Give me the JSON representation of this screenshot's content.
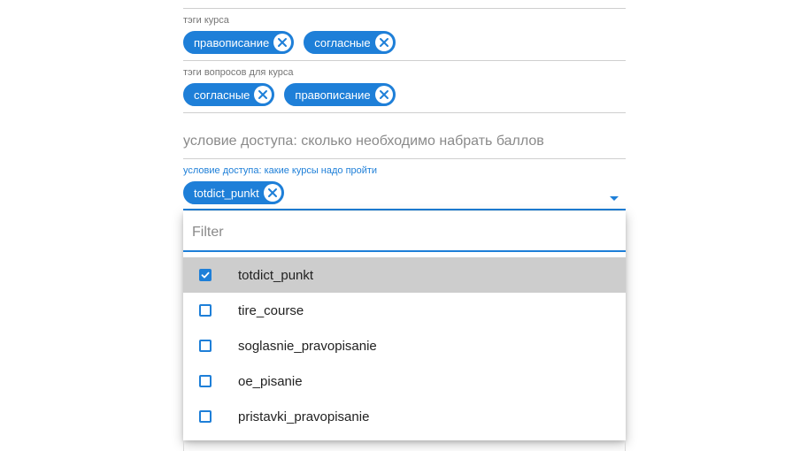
{
  "course_tags": {
    "label": "тэги курса",
    "chips": [
      "правописание",
      "согласные"
    ]
  },
  "question_tags": {
    "label": "тэги вопросов для курса",
    "chips": [
      "согласные",
      "правописание"
    ]
  },
  "access_points": {
    "placeholder": "условие доступа: сколько необходимо набрать баллов"
  },
  "access_courses": {
    "label": "условие доступа: какие курсы надо пройти",
    "chips": [
      "totdict_punkt"
    ],
    "caret_icon": "arrow-drop-down-icon"
  },
  "dropdown": {
    "filter_placeholder": "Filter",
    "options": [
      {
        "label": "totdict_punkt",
        "checked": true
      },
      {
        "label": "tire_course",
        "checked": false
      },
      {
        "label": "soglasnie_pravopisanie",
        "checked": false
      },
      {
        "label": "oe_pisanie",
        "checked": false
      },
      {
        "label": "pristavki_pravopisanie",
        "checked": false
      }
    ]
  },
  "colors": {
    "accent": "#1e7fd8",
    "selected_row": "#cdcdcd",
    "divider": "#cfcfcf"
  }
}
